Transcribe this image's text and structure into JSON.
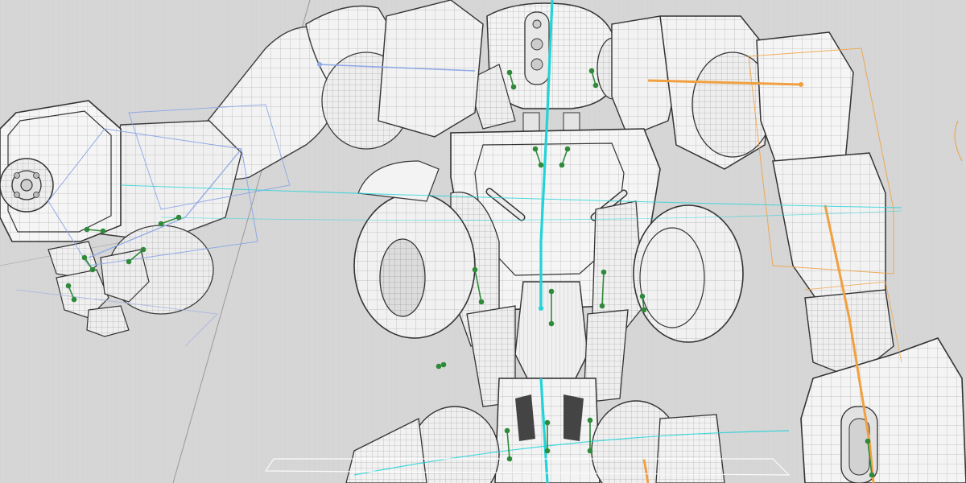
{
  "viewport": {
    "background": "#d6d6d6",
    "mesh_fill": "#f4f4f4",
    "mesh_fill_shade": "#e6e6e6",
    "wire_color": "#4a4a4a",
    "spine_color": "#22d3d8",
    "left_rig_color": "#8fa8e6",
    "right_rig_color": "#f0a040",
    "joint_color": "#2f8a3a"
  },
  "scene": {
    "subject": "robot-wireframe",
    "render_mode": "wireframe-on-shaded"
  }
}
